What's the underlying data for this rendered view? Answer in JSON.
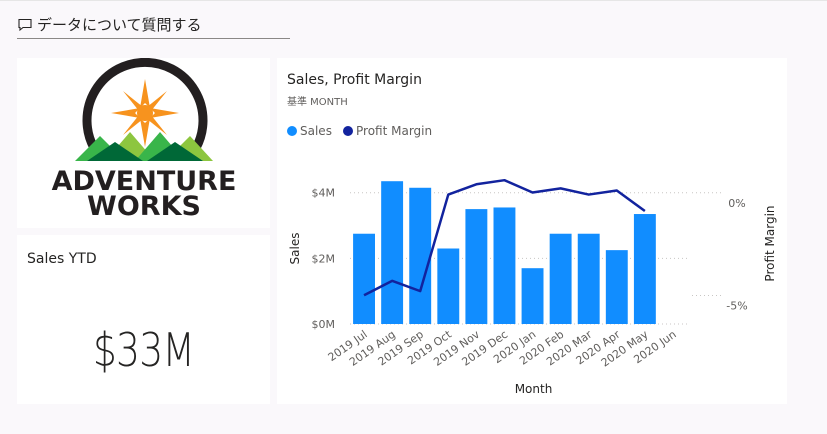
{
  "qa": {
    "label": "データについて質問する"
  },
  "logo": {
    "line1": "ADVENTURE",
    "line2": "WORKS"
  },
  "card": {
    "title": "Sales YTD",
    "value": "$33M"
  },
  "chart_data": {
    "type": "bar",
    "title": "Sales, Profit Margin",
    "subtitle": "基準 MONTH",
    "xlabel": "Month",
    "ylabel": "Sales",
    "y2label": "Profit Margin",
    "categories": [
      "2019 Jul",
      "2019 Aug",
      "2019 Sep",
      "2019 Oct",
      "2019 Nov",
      "2019 Dec",
      "2020 Jan",
      "2020 Feb",
      "2020 Mar",
      "2020 Apr",
      "2020 May",
      "2020 Jun"
    ],
    "series": [
      {
        "name": "Sales",
        "kind": "bar",
        "axis": "left",
        "color": "#118dff",
        "values": [
          2.75,
          4.35,
          4.15,
          2.3,
          3.5,
          3.55,
          1.7,
          2.75,
          2.75,
          2.25,
          3.35
        ]
      },
      {
        "name": "Profit Margin",
        "kind": "line",
        "axis": "right",
        "color": "#12239e",
        "values": [
          -4.5,
          -3.8,
          -4.3,
          0.4,
          0.9,
          1.1,
          0.5,
          0.7,
          0.4,
          0.6,
          -0.4
        ]
      }
    ],
    "ylim": [
      0,
      4.6
    ],
    "yticks": [
      0,
      2,
      4
    ],
    "ytick_labels": [
      "$0M",
      "$2M",
      "$4M"
    ],
    "y2lim": [
      -5.9,
      1.45
    ],
    "y2ticks": [
      0,
      -5
    ],
    "y2tick_labels": [
      "0%",
      "-5%"
    ],
    "legend_position": "top-left",
    "grid": true
  }
}
